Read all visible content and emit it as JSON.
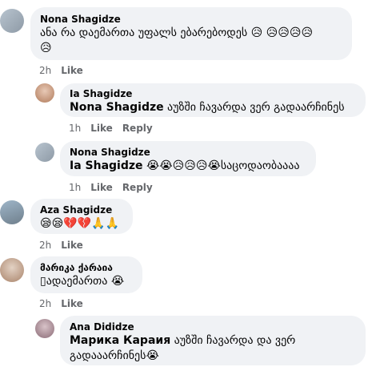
{
  "comments": [
    {
      "author": "Nona Shagidze",
      "text": "ანა რა დაემართა უფალს ებარებოდეს 😥 😥😥😥😥",
      "text2": "😥",
      "time": "2h",
      "like": "Like"
    },
    {
      "author": "Ia Shagidze",
      "mention": "Nona Shagidze",
      "text": " აუზში ჩავარდა ვერ გადაარჩინეს",
      "time": "1h",
      "like": "Like",
      "reply": "Reply"
    },
    {
      "author": "Nona Shagidze",
      "mention": "Ia Shagidze",
      "text": " 😭😭😥😥😥😭საცოდაობაააა",
      "time": "1h",
      "like": "Like",
      "reply": "Reply"
    },
    {
      "author": "Aza Shagidze",
      "text": "😪😪💔💔🙏🙏",
      "time": "2h",
      "like": "Like"
    },
    {
      "author": "მარიკა ქარაია",
      "text": "▯ადაემართა 😭",
      "time": "2h",
      "like": "Like"
    },
    {
      "author": "Ana Dididze",
      "mention": "Марика Караия",
      "text": " აუზში ჩავარდა და ვერ",
      "text2": "გადააარჩინეს😭"
    }
  ],
  "colors": {
    "bubble": "#f0f2f5",
    "meta": "#65676b",
    "text": "#050505"
  }
}
